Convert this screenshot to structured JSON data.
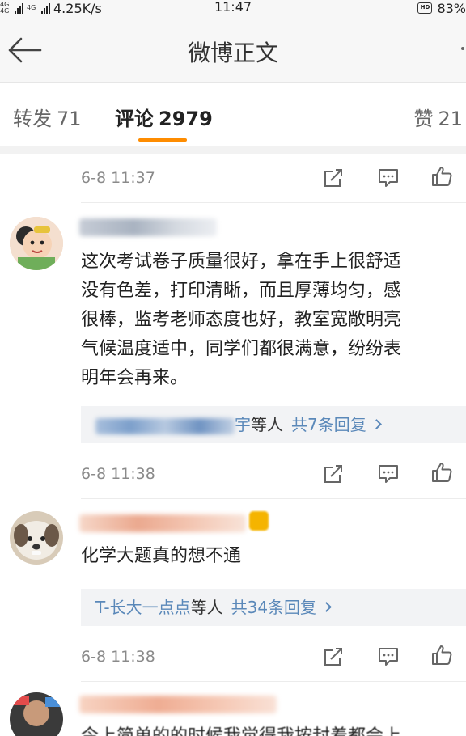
{
  "status_bar": {
    "network": "4G 4G",
    "network2": "4G",
    "speed": "4.25K/s",
    "time": "11:47",
    "hd": "HD",
    "battery": "83%"
  },
  "header": {
    "title": "微博正文"
  },
  "tabs": {
    "repost_label": "转发",
    "repost_count": "71",
    "comment_label": "评论",
    "comment_count": "2979",
    "like_label": "赞",
    "like_count": "21"
  },
  "comments": [
    {
      "time": "6-8 11:37"
    },
    {
      "lines": [
        "这次考试卷子质量很好，拿在手上很舒适",
        "没有色差，打印清晰，而且厚薄均匀，感",
        "很棒，监考老师态度也好，教室宽敞明亮",
        "气候温度适中，同学们都很满意，纷纷表",
        "明年会再来。"
      ],
      "reply_name_tail": "宇",
      "reply_others": "等人",
      "reply_count": "共7条回复",
      "time": "6-8 11:38"
    },
    {
      "text": "化学大题真的想不通",
      "reply_name": "T-长大一点点",
      "reply_others": "等人",
      "reply_count": "共34条回复",
      "time": "6-8 11:38"
    },
    {
      "partial_text": "今上简单的的时候我觉得我按封着都会上"
    }
  ],
  "colors": {
    "accent": "#fe8c00",
    "link": "#5a88b9",
    "muted": "#8a8a8a"
  },
  "icons": [
    "back-arrow-icon",
    "more-icon",
    "share-icon",
    "comment-icon",
    "thumbs-up-icon",
    "vip-badge-icon"
  ]
}
